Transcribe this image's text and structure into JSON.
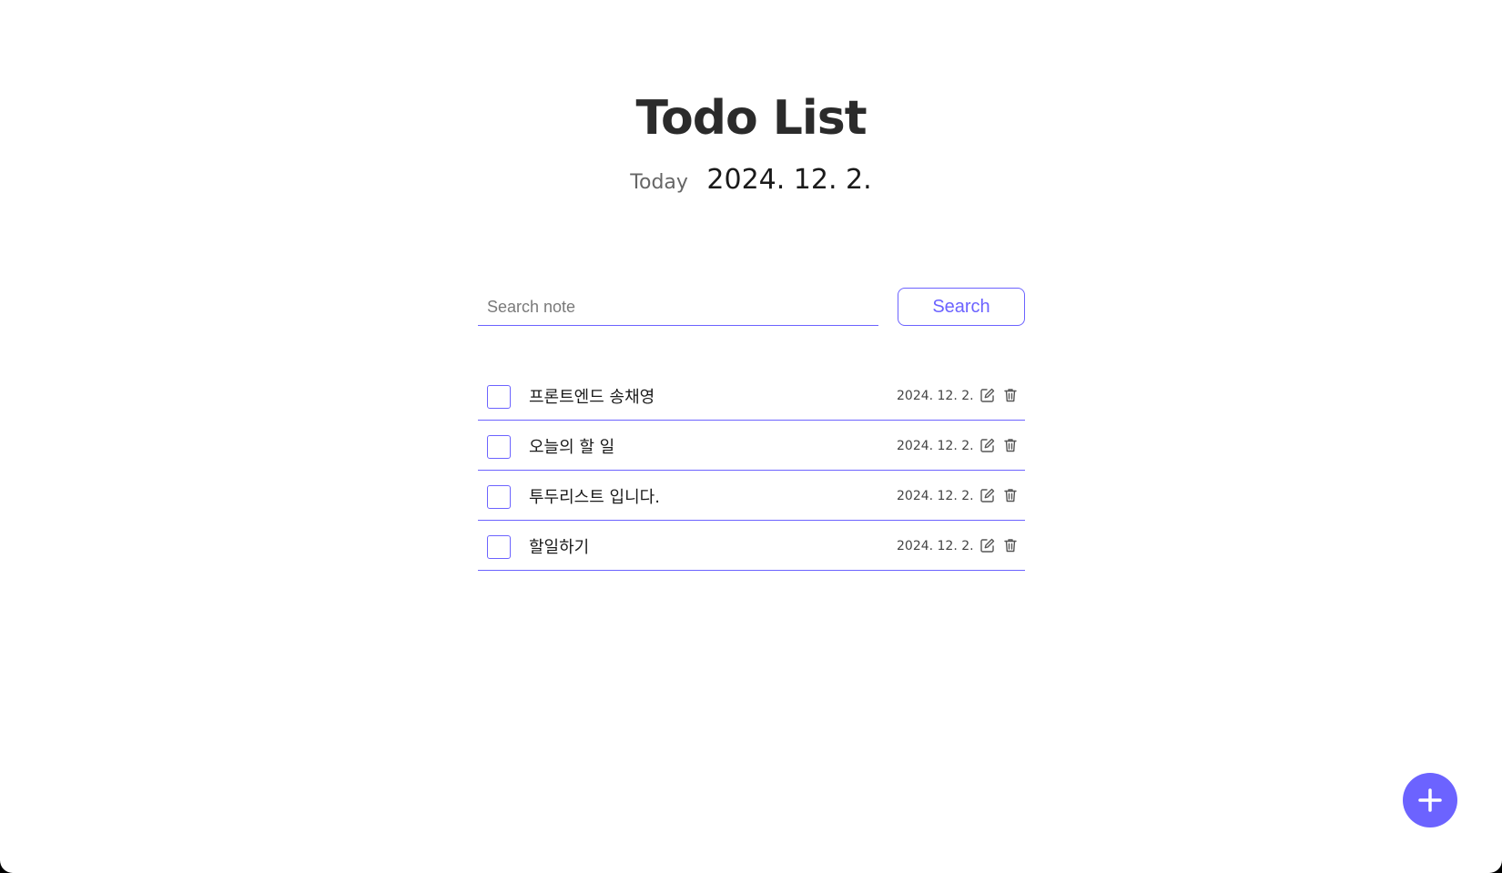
{
  "header": {
    "title": "Todo List",
    "today_label": "Today",
    "today_date": "2024. 12. 2."
  },
  "search": {
    "placeholder": "Search note",
    "value": "",
    "button_label": "Search"
  },
  "todos": [
    {
      "text": "프론트엔드 송채영",
      "date": "2024. 12. 2.",
      "checked": false
    },
    {
      "text": "오늘의 할 일",
      "date": "2024. 12. 2.",
      "checked": false
    },
    {
      "text": "투두리스트 입니다.",
      "date": "2024. 12. 2.",
      "checked": false
    },
    {
      "text": "할일하기",
      "date": "2024. 12. 2.",
      "checked": false
    }
  ],
  "icons": {
    "edit": "edit-icon",
    "delete": "trash-icon",
    "add": "plus-icon"
  },
  "colors": {
    "accent": "#6c63ff",
    "title": "#2b2b2b",
    "background": "#ffffff"
  }
}
